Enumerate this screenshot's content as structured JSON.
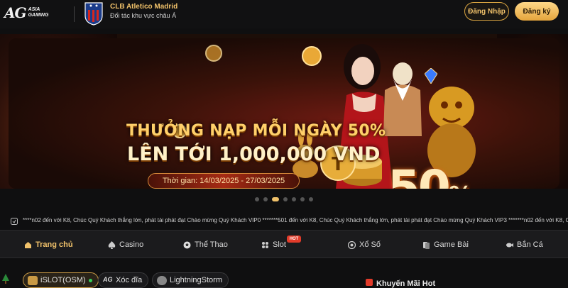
{
  "header": {
    "logo_mark": "AG",
    "logo_text_line1": "ASIA",
    "logo_text_line2": "GAMING",
    "club_title": "CLB Atletico Madrid",
    "club_subtitle": "Đối tác khu vực châu Á",
    "login_label": "Đăng Nhập",
    "register_label": "Đăng ký"
  },
  "banner": {
    "headline": "THƯỞNG NẠP MỖI NGÀY 50%",
    "amount": "LÊN TỚI 1,000,000 VND",
    "period": "Thời gian: 14/03/2025 - 27/03/2025",
    "big_percent": "50",
    "percent_sign": "%",
    "slide_count": 7,
    "active_slide": 3
  },
  "marquee": {
    "text": "****n02 đến với K8, Chúc Quý Khách thắng lớn, phát tài phát đạt Chào mừng Quý Khách VIP0 *******501 đến với K8, Chúc Quý Khách thắng lớn, phát tài phát đạt Chào mừng Quý Khách VIP3 *******n02 đến với K8, Chúc"
  },
  "nav": {
    "items": [
      {
        "label": "Trang chủ",
        "icon": "home-icon",
        "active": true
      },
      {
        "label": "Casino",
        "icon": "spade-icon",
        "active": false
      },
      {
        "label": "Thể Thao",
        "icon": "soccer-ball-icon",
        "active": false
      },
      {
        "label": "Slot",
        "icon": "slot-icon",
        "active": false
      },
      {
        "label": "Xổ Số",
        "icon": "lottery-icon",
        "active": false
      },
      {
        "label": "Game Bài",
        "icon": "cards-icon",
        "active": false
      },
      {
        "label": "Bắn Cá",
        "icon": "fish-icon",
        "active": false
      }
    ],
    "hot_badge": "HOT"
  },
  "providers": {
    "items": [
      {
        "label": "iSLOT(OSM)",
        "icon": "islot-icon",
        "active": true
      },
      {
        "label": "Xóc đĩa",
        "icon": "ag-icon",
        "active": false
      },
      {
        "label": "LightningStorm",
        "icon": "storm-icon",
        "active": false
      }
    ]
  },
  "promo_section": {
    "label": "Khuyến Mãi Hot"
  },
  "colors": {
    "accent": "#f0c16a",
    "background": "#0f0f10",
    "hot": "#e23b2a"
  }
}
